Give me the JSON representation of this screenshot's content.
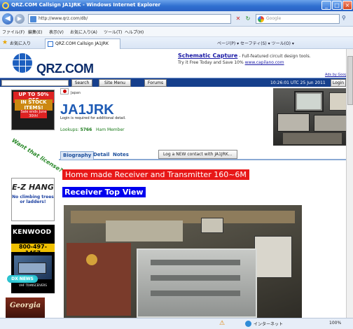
{
  "window": {
    "title": "QRZ.COM Callsign JA1JRK - Windows Internet Explorer",
    "min": "_",
    "max": "□",
    "close": "×"
  },
  "address_bar": {
    "url": "http://www.qrz.com/db/",
    "search_placeholder": "Google"
  },
  "menu": [
    "ファイル(F)",
    "編集(E)",
    "表示(V)",
    "お気に入り(A)",
    "ツール(T)",
    "ヘルプ(H)"
  ],
  "favorites_bar": {
    "favorites_label": "お気に入り",
    "tab_title": "QRZ.COM Callsign JA1JRK",
    "command_bar": "ページ(P) ▾  セーフティ(S) ▾  ツール(O) ▾"
  },
  "site": {
    "logo_text": "QRZ.COM",
    "ad": {
      "headline": "Schematic Capture",
      "desc": " - Full-featured circuit design tools.",
      "line2_prefix": "Try it Free Today and Save 10% ",
      "link": "www.capilano.com",
      "ads_by": "Ads by Google"
    },
    "nav": {
      "search_button": "Search",
      "site_menu_button": "Site Menu",
      "forums_button": "Forums",
      "datetime": "10:26:01 UTC 25 Jun 2011",
      "login_button": "Login"
    }
  },
  "sidebar": {
    "ad1": {
      "line1": "UP TO 50% OFF",
      "line2": "IN STOCK ITEMS!",
      "line3": "Sale ends June 30th!"
    },
    "ad2": "Want that license?",
    "ad3": {
      "title": "E-Z HANG",
      "sub": "No climbing trees or ladders!"
    },
    "ad4": {
      "brand": "KENWOOD",
      "phone": "800-497-1457",
      "caption": "VHF TRANSCEIVERS"
    },
    "dx_news": "DX NEWS",
    "ad5": "Georgia"
  },
  "profile": {
    "country": "Japan",
    "callsign": "JA1JRK",
    "login_note": "Login is required for additional detail.",
    "lookups_label": "Lookups:",
    "lookups_value": "5766",
    "member": "Ham Member",
    "tabs": [
      "Biography",
      "Detail",
      "Notes"
    ],
    "log_button": "Log a NEW contact with JA1JRK..."
  },
  "biography": {
    "heading1": "Home made Receiver and Transmitter 160~6M",
    "heading2": "Receiver Top View"
  },
  "status_bar": {
    "zone": "インターネット",
    "zoom": "100%"
  }
}
